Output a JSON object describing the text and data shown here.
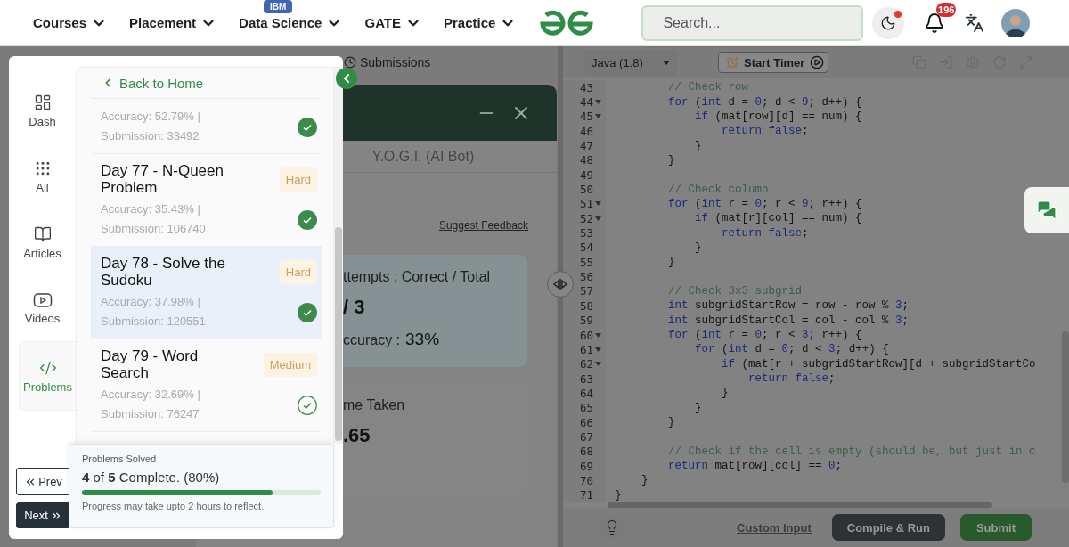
{
  "nav": {
    "items": [
      {
        "label": "Courses"
      },
      {
        "label": "Placement"
      },
      {
        "label": "Data Science",
        "badge": "IBM"
      },
      {
        "label": "GATE"
      },
      {
        "label": "Practice"
      }
    ],
    "search": {
      "placeholder": "Search..."
    },
    "theme_button": {
      "notification_dot": true
    },
    "notifications": {
      "count": "196"
    }
  },
  "submissions_tab": {
    "label": "Submissions"
  },
  "chat_window": {
    "tab": "Y.O.G.I. (AI Bot)",
    "feedback_link": "Suggest Feedback",
    "attempts_card": {
      "label": "ttempts : Correct / Total",
      "value": "/ 3",
      "accuracy_label": "ccuracy :",
      "accuracy": "33%"
    },
    "time_card": {
      "label": "me Taken",
      "value": ".65"
    }
  },
  "drawer": {
    "rail": [
      {
        "kind": "dashboard",
        "label": "Dash",
        "selected": false
      },
      {
        "kind": "grid",
        "label": "All",
        "selected": false
      },
      {
        "kind": "book",
        "label": "Articles",
        "selected": false
      },
      {
        "kind": "video",
        "label": "Videos",
        "selected": false
      },
      {
        "kind": "code",
        "label": "Problems",
        "selected": true
      }
    ],
    "prev": "Prev",
    "next": "Next",
    "back_link": "Back to Home",
    "problems": [
      {
        "stats": "Accuracy: 52.79% | Submission: 33492",
        "solved": true,
        "selected": false
      },
      {
        "title": "Day 77 - N-Queen Problem",
        "difficulty": "Hard",
        "stats": "Accuracy: 35.43% | Submission: 106740",
        "solved": true,
        "selected": false
      },
      {
        "title": "Day 78 - Solve the Sudoku",
        "difficulty": "Hard",
        "stats": "Accuracy: 37.98% | Submission: 120551",
        "solved": true,
        "selected": true
      },
      {
        "title": "Day 79 - Word Search",
        "difficulty": "Medium",
        "stats": "Accuracy: 32.69% | Submission: 76247",
        "solved": false,
        "selected": false
      }
    ],
    "progress": {
      "title": "Problems Solved",
      "summary": "**4** of **5** Complete. (80%)",
      "level": 0.8,
      "note": "Progress may take upto 2 hours to reflect."
    }
  },
  "editor": {
    "language": "Java (1.8)",
    "timer": "Start Timer",
    "lines": [
      {
        "no": "43",
        "fold": false,
        "tokens": [
          {
            "kind": "cm",
            "text": "        // Check row"
          }
        ]
      },
      {
        "no": "44",
        "fold": true,
        "tokens": [
          {
            "kind": "kw",
            "text": "        for"
          },
          {
            "kind": "tx",
            "text": " ("
          },
          {
            "kind": "kw",
            "text": "int"
          },
          {
            "kind": "tx",
            "text": " d = "
          },
          {
            "kind": "kw",
            "text": "0"
          },
          {
            "kind": "tx",
            "text": "; d < "
          },
          {
            "kind": "kw",
            "text": "9"
          },
          {
            "kind": "tx",
            "text": "; d++) {"
          }
        ]
      },
      {
        "no": "45",
        "fold": true,
        "tokens": [
          {
            "kind": "kw",
            "text": "            if"
          },
          {
            "kind": "tx",
            "text": " (mat[row][d] == num) {"
          }
        ]
      },
      {
        "no": "46",
        "fold": false,
        "tokens": [
          {
            "kind": "kw",
            "text": "                return false"
          },
          {
            "kind": "tx",
            "text": ";"
          }
        ]
      },
      {
        "no": "47",
        "fold": false,
        "tokens": [
          {
            "kind": "tx",
            "text": "            }"
          }
        ]
      },
      {
        "no": "48",
        "fold": false,
        "tokens": [
          {
            "kind": "tx",
            "text": "        }"
          }
        ]
      },
      {
        "no": "49",
        "fold": false
      },
      {
        "no": "50",
        "fold": false,
        "tokens": [
          {
            "kind": "cm",
            "text": "        // Check column"
          }
        ]
      },
      {
        "no": "51",
        "fold": true,
        "tokens": [
          {
            "kind": "kw",
            "text": "        for"
          },
          {
            "kind": "tx",
            "text": " ("
          },
          {
            "kind": "kw",
            "text": "int"
          },
          {
            "kind": "tx",
            "text": " r = "
          },
          {
            "kind": "kw",
            "text": "0"
          },
          {
            "kind": "tx",
            "text": "; r < "
          },
          {
            "kind": "kw",
            "text": "9"
          },
          {
            "kind": "tx",
            "text": "; r++) {"
          }
        ]
      },
      {
        "no": "52",
        "fold": true,
        "tokens": [
          {
            "kind": "kw",
            "text": "            if"
          },
          {
            "kind": "tx",
            "text": " (mat[r][col] == num) {"
          }
        ]
      },
      {
        "no": "53",
        "fold": false,
        "tokens": [
          {
            "kind": "kw",
            "text": "                return false"
          },
          {
            "kind": "tx",
            "text": ";"
          }
        ]
      },
      {
        "no": "54",
        "fold": false,
        "tokens": [
          {
            "kind": "tx",
            "text": "            }"
          }
        ]
      },
      {
        "no": "55",
        "fold": false,
        "tokens": [
          {
            "kind": "tx",
            "text": "        }"
          }
        ]
      },
      {
        "no": "56",
        "fold": false
      },
      {
        "no": "57",
        "fold": false,
        "tokens": [
          {
            "kind": "cm",
            "text": "        // Check 3x3 subgrid"
          }
        ]
      },
      {
        "no": "58",
        "fold": false,
        "tokens": [
          {
            "kind": "kw",
            "text": "        int"
          },
          {
            "kind": "tx",
            "text": " subgridStartRow = row - row % "
          },
          {
            "kind": "kw",
            "text": "3"
          },
          {
            "kind": "tx",
            "text": ";"
          }
        ]
      },
      {
        "no": "59",
        "fold": false,
        "tokens": [
          {
            "kind": "kw",
            "text": "        int"
          },
          {
            "kind": "tx",
            "text": " subgridStartCol = col - col % "
          },
          {
            "kind": "kw",
            "text": "3"
          },
          {
            "kind": "tx",
            "text": ";"
          }
        ]
      },
      {
        "no": "60",
        "fold": true,
        "tokens": [
          {
            "kind": "kw",
            "text": "        for"
          },
          {
            "kind": "tx",
            "text": " ("
          },
          {
            "kind": "kw",
            "text": "int"
          },
          {
            "kind": "tx",
            "text": " r = "
          },
          {
            "kind": "kw",
            "text": "0"
          },
          {
            "kind": "tx",
            "text": "; r < "
          },
          {
            "kind": "kw",
            "text": "3"
          },
          {
            "kind": "tx",
            "text": "; r++) {"
          }
        ]
      },
      {
        "no": "61",
        "fold": true,
        "tokens": [
          {
            "kind": "kw",
            "text": "            for"
          },
          {
            "kind": "tx",
            "text": " ("
          },
          {
            "kind": "kw",
            "text": "int"
          },
          {
            "kind": "tx",
            "text": " d = "
          },
          {
            "kind": "kw",
            "text": "0"
          },
          {
            "kind": "tx",
            "text": "; d < "
          },
          {
            "kind": "kw",
            "text": "3"
          },
          {
            "kind": "tx",
            "text": "; d++) {"
          }
        ]
      },
      {
        "no": "62",
        "fold": true,
        "tokens": [
          {
            "kind": "kw",
            "text": "                if"
          },
          {
            "kind": "tx",
            "text": " (mat[r + subgridStartRow][d + subgridStartCo"
          }
        ]
      },
      {
        "no": "63",
        "fold": false,
        "tokens": [
          {
            "kind": "kw",
            "text": "                    return false"
          },
          {
            "kind": "tx",
            "text": ";"
          }
        ]
      },
      {
        "no": "64",
        "fold": false,
        "tokens": [
          {
            "kind": "tx",
            "text": "                }"
          }
        ]
      },
      {
        "no": "65",
        "fold": false,
        "tokens": [
          {
            "kind": "tx",
            "text": "            }"
          }
        ]
      },
      {
        "no": "66",
        "fold": false,
        "tokens": [
          {
            "kind": "tx",
            "text": "        }"
          }
        ]
      },
      {
        "no": "67",
        "fold": false
      },
      {
        "no": "68",
        "fold": false,
        "tokens": [
          {
            "kind": "cm",
            "text": "        // Check if the cell is empty (should be, but just in c"
          }
        ]
      },
      {
        "no": "69",
        "fold": false,
        "tokens": [
          {
            "kind": "kw",
            "text": "        return"
          },
          {
            "kind": "tx",
            "text": " mat[row][col] == "
          },
          {
            "kind": "kw",
            "text": "0"
          },
          {
            "kind": "tx",
            "text": ";"
          }
        ]
      },
      {
        "no": "70",
        "fold": false,
        "tokens": [
          {
            "kind": "tx",
            "text": "    }"
          }
        ]
      },
      {
        "no": "71",
        "fold": false,
        "tokens": [
          {
            "kind": "tx",
            "text": "}"
          }
        ]
      }
    ],
    "custom_input": "Custom Input",
    "run": "Compile & Run",
    "submit": "Submit"
  }
}
